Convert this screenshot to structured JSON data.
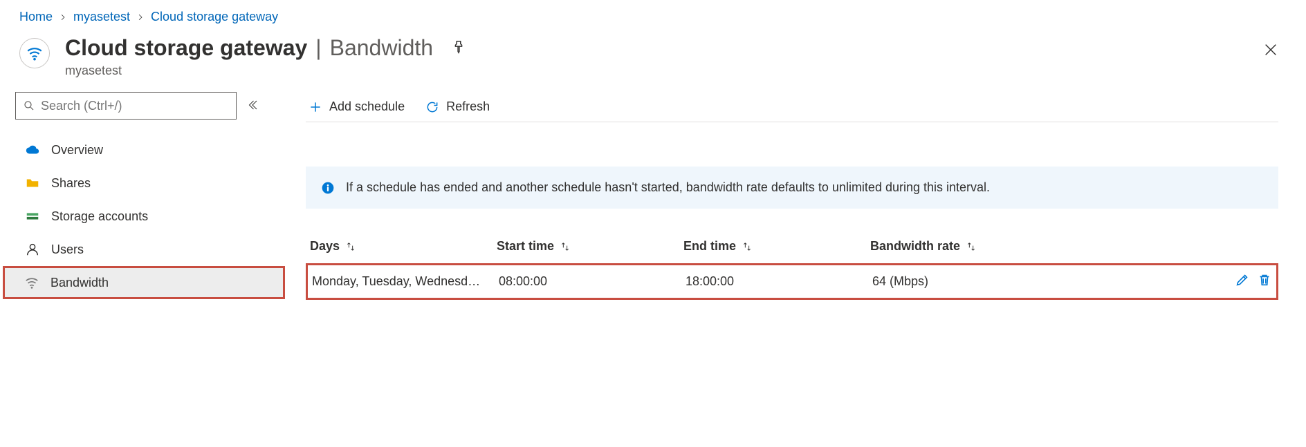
{
  "brand_color": "#0066b8",
  "breadcrumb": {
    "items": [
      {
        "label": "Home"
      },
      {
        "label": "myasetest"
      },
      {
        "label": "Cloud storage gateway"
      }
    ]
  },
  "header": {
    "title": "Cloud storage gateway",
    "section": "Bandwidth",
    "subtitle": "myasetest"
  },
  "sidebar": {
    "search_placeholder": "Search (Ctrl+/)",
    "items": [
      {
        "key": "overview",
        "label": "Overview",
        "icon": "cloud-icon",
        "selected": false
      },
      {
        "key": "shares",
        "label": "Shares",
        "icon": "folder-icon",
        "selected": false
      },
      {
        "key": "storage-accounts",
        "label": "Storage accounts",
        "icon": "storage-icon",
        "selected": false
      },
      {
        "key": "users",
        "label": "Users",
        "icon": "user-icon",
        "selected": false
      },
      {
        "key": "bandwidth",
        "label": "Bandwidth",
        "icon": "wifi-icon",
        "selected": true
      }
    ]
  },
  "commands": {
    "add": "Add schedule",
    "refresh": "Refresh"
  },
  "info": {
    "text": "If a schedule has ended and another schedule hasn't started, bandwidth rate defaults to unlimited during this interval."
  },
  "table": {
    "columns": {
      "days": "Days",
      "start": "Start time",
      "end": "End time",
      "rate": "Bandwidth rate"
    },
    "rows": [
      {
        "days": "Monday, Tuesday, Wednesd…",
        "start": "08:00:00",
        "end": "18:00:00",
        "rate": "64 (Mbps)"
      }
    ]
  }
}
